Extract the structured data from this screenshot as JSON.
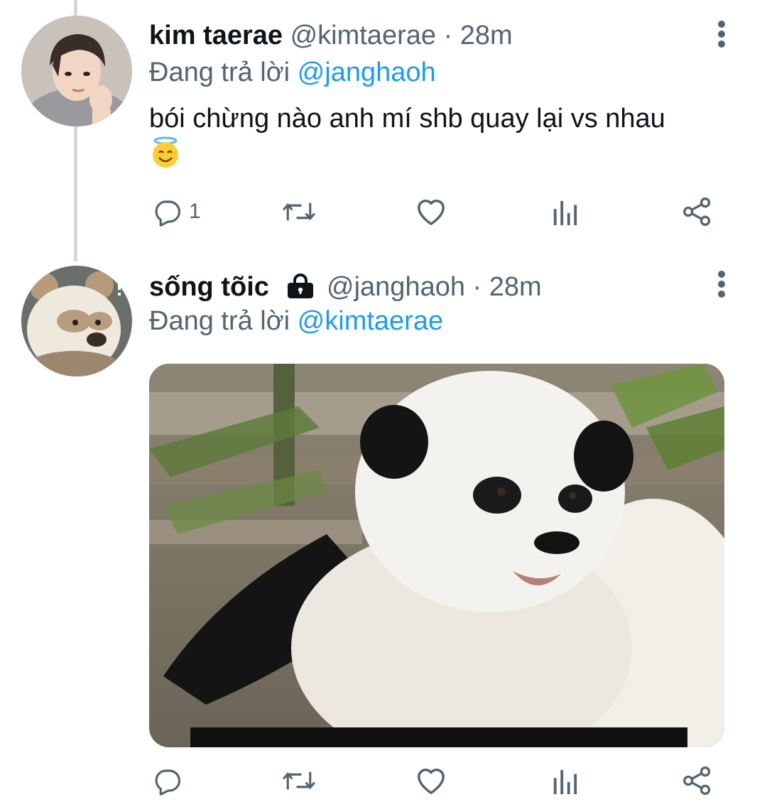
{
  "tweets": [
    {
      "display_name": "kim taerae",
      "handle": "@kimtaerae",
      "separator": "·",
      "time": "28m",
      "reply_prefix": "Đang trả lời",
      "reply_mention": "@janghaoh",
      "text": "bói chừng nào anh mí shb quay lại vs nhau",
      "emoji": "smiling-face-with-halo",
      "reply_count": "1",
      "avatar": "person-photo"
    },
    {
      "display_name": "sống tõic",
      "protected": true,
      "handle": "@janghaoh",
      "separator": "·",
      "time": "28m",
      "reply_prefix": "Đang trả lời",
      "reply_mention": "@kimtaerae",
      "media": "panda-photo",
      "media_caption_partial": "",
      "avatar": "panda-photo"
    }
  ],
  "icons": {
    "reply": "reply-icon",
    "retweet": "retweet-icon",
    "like": "heart-icon",
    "analytics": "analytics-icon",
    "share": "share-icon",
    "more": "more-vertical-icon",
    "lock": "lock-icon"
  },
  "colors": {
    "text_primary": "#0f1419",
    "text_secondary": "#536471",
    "mention": "#1d9bf0",
    "thread_line": "#cfd9de",
    "icon": "#536471"
  }
}
